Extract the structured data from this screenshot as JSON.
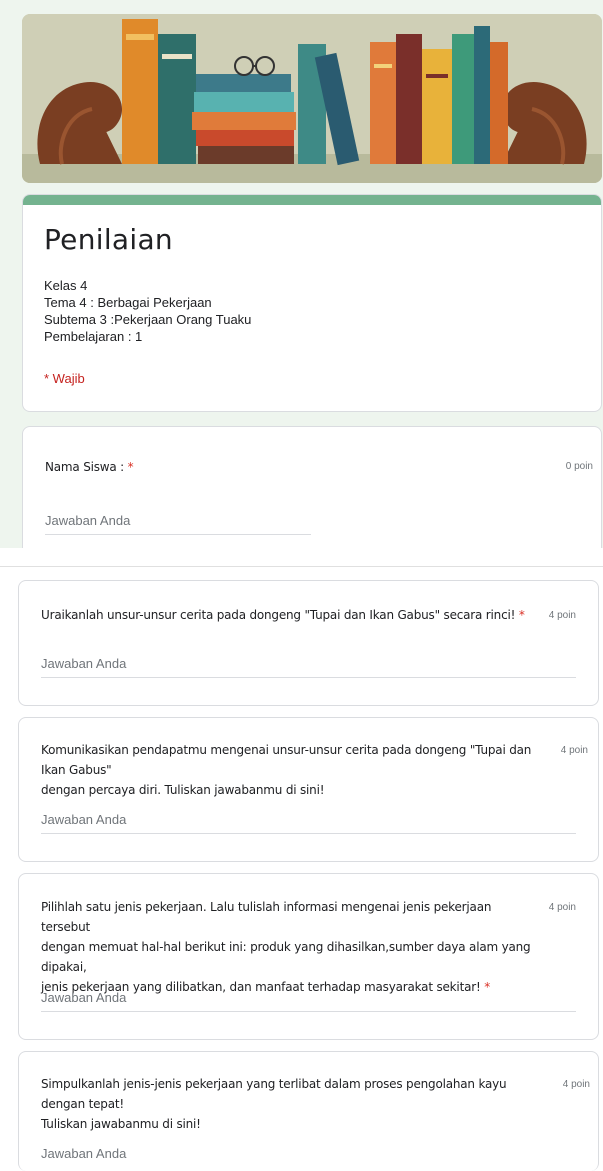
{
  "form": {
    "title": "Penilaian",
    "description_lines": [
      "Kelas 4",
      "Tema 4 : Berbagai Pekerjaan",
      "Subtema 3 :Pekerjaan Orang Tuaku",
      "Pembelajaran : 1"
    ],
    "required_note": "* Wajib",
    "answer_placeholder": "Jawaban Anda"
  },
  "questions": [
    {
      "text": "Nama Siswa :",
      "required_mark": "*",
      "points": "0 poin"
    },
    {
      "text": "Uraikanlah unsur-unsur cerita pada dongeng \"Tupai dan Ikan Gabus\" secara rinci!",
      "required_mark": "*",
      "points": "4 poin"
    },
    {
      "text_lines": [
        "Komunikasikan pendapatmu mengenai unsur-unsur cerita pada dongeng \"Tupai dan Ikan Gabus\"",
        "dengan percaya diri. Tuliskan jawabanmu di sini!"
      ],
      "points": "4 poin"
    },
    {
      "text_lines": [
        "Pilihlah satu jenis pekerjaan. Lalu tulislah informasi mengenai jenis pekerjaan tersebut",
        "dengan memuat hal-hal berikut ini: produk yang dihasilkan,sumber daya alam yang dipakai,",
        "jenis pekerjaan yang dilibatkan, dan manfaat terhadap masyarakat sekitar!"
      ],
      "required_mark": "*",
      "points": "4 poin"
    },
    {
      "text_lines": [
        "Simpulkanlah jenis-jenis pekerjaan yang terlibat dalam proses pengolahan kayu dengan tepat!",
        "Tuliskan jawabanmu di sini!"
      ],
      "points": "4 poin"
    }
  ],
  "colors": {
    "accent": "#74b38f",
    "required": "#d93025",
    "background": "#eef5ee"
  }
}
